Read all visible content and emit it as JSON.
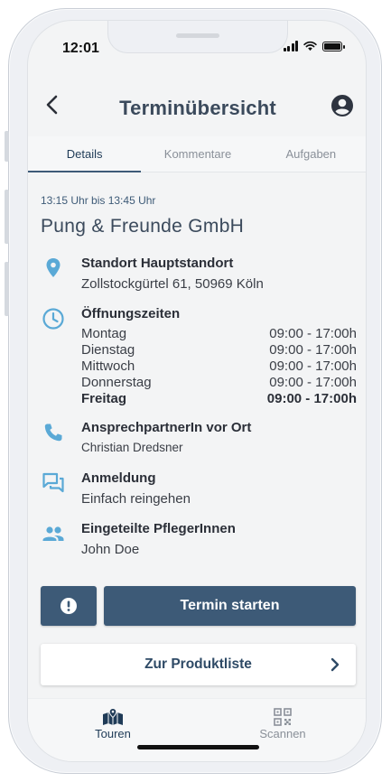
{
  "status_bar": {
    "time": "12:01"
  },
  "header": {
    "title": "Terminübersicht"
  },
  "tabs": [
    {
      "label": "Details",
      "active": true
    },
    {
      "label": "Kommentare",
      "active": false
    },
    {
      "label": "Aufgaben",
      "active": false
    }
  ],
  "appointment": {
    "time_range": "13:15 Uhr bis 13:45 Uhr",
    "company": "Pung & Freunde GmbH"
  },
  "location": {
    "heading": "Standort Hauptstandort",
    "address": "Zollstockgürtel 61, 50969 Köln",
    "icon": "location-pin-icon"
  },
  "opening_hours": {
    "heading": "Öffnungszeiten",
    "icon": "clock-icon",
    "days": [
      {
        "day": "Montag",
        "hours": "09:00 - 17:00h",
        "bold": false
      },
      {
        "day": "Dienstag",
        "hours": "09:00 - 17:00h",
        "bold": false
      },
      {
        "day": "Mittwoch",
        "hours": "09:00 - 17:00h",
        "bold": false
      },
      {
        "day": "Donnerstag",
        "hours": "09:00 - 17:00h",
        "bold": false
      },
      {
        "day": "Freitag",
        "hours": "09:00 - 17:00h",
        "bold": true
      }
    ]
  },
  "contact": {
    "heading": "AnsprechpartnerIn vor Ort",
    "name": "Christian Dredsner",
    "icon": "phone-icon"
  },
  "registration": {
    "heading": "Anmeldung",
    "value": "Einfach reingehen",
    "icon": "chat-icon"
  },
  "caregivers": {
    "heading": "Eingeteilte PflegerInnen",
    "value": "John Doe",
    "icon": "people-icon"
  },
  "actions": {
    "alert_icon": "exclamation-icon",
    "start_label": "Termin starten",
    "product_list_label": "Zur Produktliste"
  },
  "bottom_nav": [
    {
      "label": "Touren",
      "icon": "map-icon",
      "active": true
    },
    {
      "label": "Scannen",
      "icon": "qr-code-icon",
      "active": false
    }
  ],
  "colors": {
    "primary": "#3d5a77",
    "title": "#3b4a5c",
    "icon_accent": "#5aa9d6",
    "background": "#f3f4f5"
  }
}
